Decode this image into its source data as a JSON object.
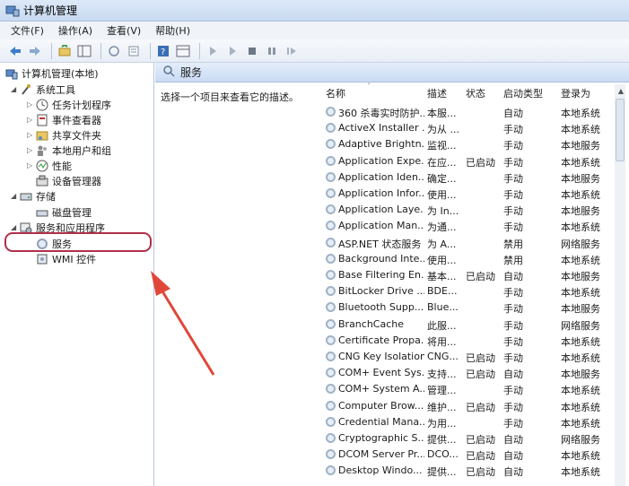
{
  "window": {
    "title": "计算机管理"
  },
  "menu": [
    "文件(F)",
    "操作(A)",
    "查看(V)",
    "帮助(H)"
  ],
  "tree": {
    "root": "计算机管理(本地)",
    "system_tools": "系统工具",
    "task_scheduler": "任务计划程序",
    "event_viewer": "事件查看器",
    "shared_folders": "共享文件夹",
    "local_users": "本地用户和组",
    "performance": "性能",
    "device_manager": "设备管理器",
    "storage": "存储",
    "disk_management": "磁盘管理",
    "services_apps": "服务和应用程序",
    "services": "服务",
    "wmi": "WMI 控件"
  },
  "panel": {
    "title": "服务",
    "description": "选择一个项目来查看它的描述。"
  },
  "columns": {
    "name": "名称",
    "desc": "描述",
    "status": "状态",
    "startup": "启动类型",
    "logon": "登录为"
  },
  "services": [
    {
      "name": "360 杀毒实时防护...",
      "desc": "本服...",
      "status": "",
      "startup": "自动",
      "logon": "本地系统"
    },
    {
      "name": "ActiveX Installer ...",
      "desc": "为从 ...",
      "status": "",
      "startup": "手动",
      "logon": "本地系统"
    },
    {
      "name": "Adaptive Brightn...",
      "desc": "监视...",
      "status": "",
      "startup": "手动",
      "logon": "本地服务"
    },
    {
      "name": "Application Expe...",
      "desc": "在应...",
      "status": "已启动",
      "startup": "手动",
      "logon": "本地系统"
    },
    {
      "name": "Application Iden...",
      "desc": "确定...",
      "status": "",
      "startup": "手动",
      "logon": "本地服务"
    },
    {
      "name": "Application Infor...",
      "desc": "使用...",
      "status": "",
      "startup": "手动",
      "logon": "本地系统"
    },
    {
      "name": "Application Laye...",
      "desc": "为 In...",
      "status": "",
      "startup": "手动",
      "logon": "本地服务"
    },
    {
      "name": "Application Man...",
      "desc": "为通...",
      "status": "",
      "startup": "手动",
      "logon": "本地系统"
    },
    {
      "name": "ASP.NET 状态服务",
      "desc": "为 A...",
      "status": "",
      "startup": "禁用",
      "logon": "网络服务"
    },
    {
      "name": "Background Inte...",
      "desc": "使用...",
      "status": "",
      "startup": "禁用",
      "logon": "本地系统"
    },
    {
      "name": "Base Filtering En...",
      "desc": "基本...",
      "status": "已启动",
      "startup": "自动",
      "logon": "本地服务"
    },
    {
      "name": "BitLocker Drive ...",
      "desc": "BDE...",
      "status": "",
      "startup": "手动",
      "logon": "本地系统"
    },
    {
      "name": "Bluetooth Supp...",
      "desc": "Blue...",
      "status": "",
      "startup": "手动",
      "logon": "本地服务"
    },
    {
      "name": "BranchCache",
      "desc": "此服...",
      "status": "",
      "startup": "手动",
      "logon": "网络服务"
    },
    {
      "name": "Certificate Propa...",
      "desc": "将用...",
      "status": "",
      "startup": "手动",
      "logon": "本地系统"
    },
    {
      "name": "CNG Key Isolation",
      "desc": "CNG...",
      "status": "已启动",
      "startup": "手动",
      "logon": "本地系统"
    },
    {
      "name": "COM+ Event Sys...",
      "desc": "支持...",
      "status": "已启动",
      "startup": "自动",
      "logon": "本地服务"
    },
    {
      "name": "COM+ System A...",
      "desc": "管理...",
      "status": "",
      "startup": "手动",
      "logon": "本地系统"
    },
    {
      "name": "Computer Brow...",
      "desc": "维护...",
      "status": "已启动",
      "startup": "手动",
      "logon": "本地系统"
    },
    {
      "name": "Credential Mana...",
      "desc": "为用...",
      "status": "",
      "startup": "手动",
      "logon": "本地系统"
    },
    {
      "name": "Cryptographic S...",
      "desc": "提供...",
      "status": "已启动",
      "startup": "自动",
      "logon": "网络服务"
    },
    {
      "name": "DCOM Server Pr...",
      "desc": "DCO...",
      "status": "已启动",
      "startup": "自动",
      "logon": "本地系统"
    },
    {
      "name": "Desktop Windo...",
      "desc": "提供...",
      "status": "已启动",
      "startup": "自动",
      "logon": "本地系统"
    }
  ],
  "colors": {
    "highlight": "#b0304a",
    "arrow": "#e0473a"
  }
}
